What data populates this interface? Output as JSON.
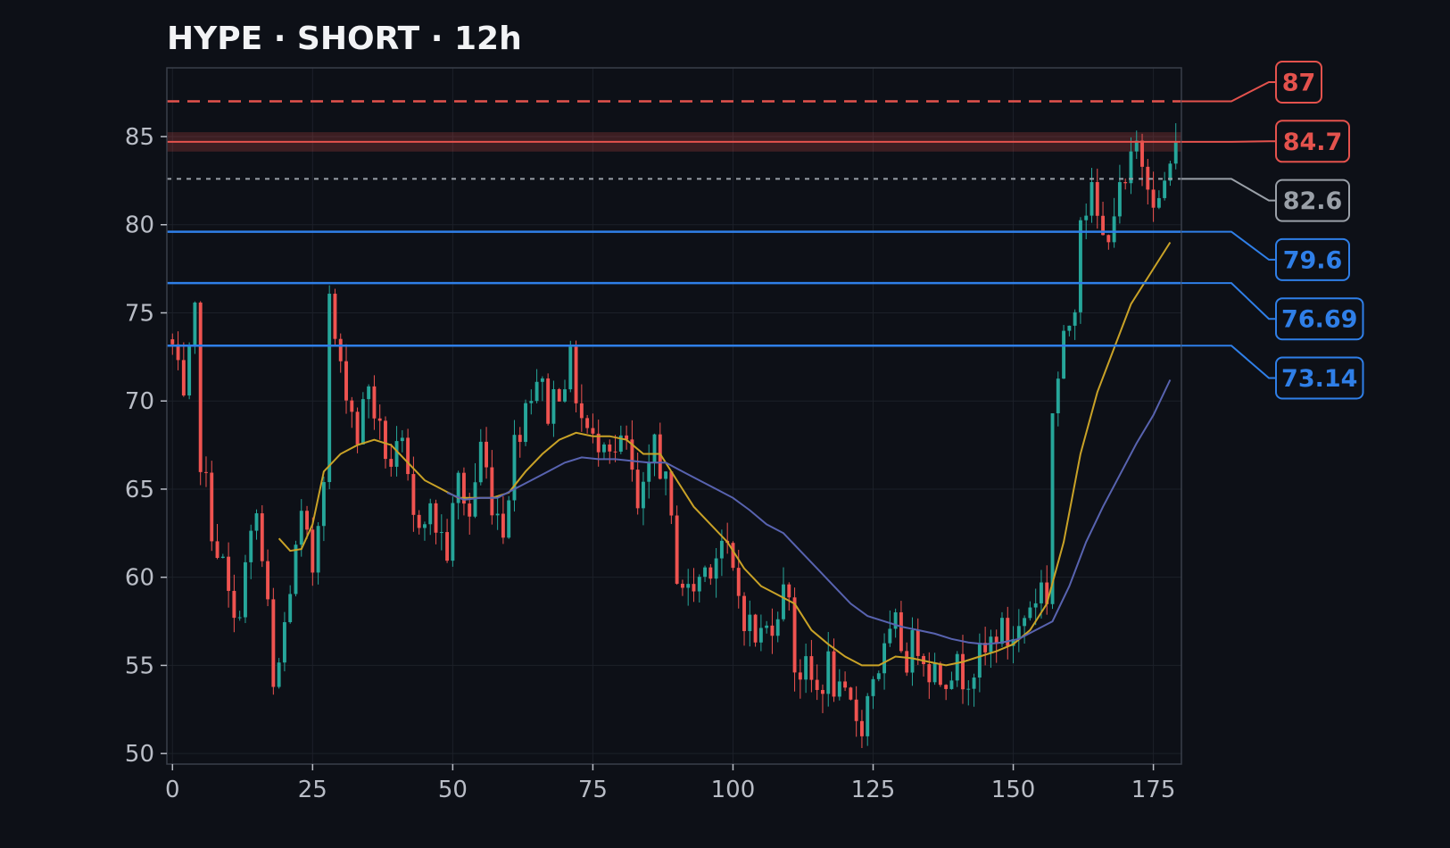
{
  "chart_data": {
    "type": "candlestick",
    "title": "HYPE · SHORT · 12h",
    "xlabel": "",
    "ylabel": "",
    "xlim": [
      -1,
      180
    ],
    "ylim": [
      49.4,
      88.9
    ],
    "x_ticks": [
      0,
      25,
      50,
      75,
      100,
      125,
      150,
      175
    ],
    "y_ticks": [
      50,
      55,
      60,
      65,
      70,
      75,
      80,
      85
    ],
    "grid": true,
    "close_path": [
      [
        0,
        73.0
      ],
      [
        2,
        69.5
      ],
      [
        4,
        74.5
      ],
      [
        5,
        67.0
      ],
      [
        7,
        63.0
      ],
      [
        9,
        60.5
      ],
      [
        11,
        57.0
      ],
      [
        13,
        60.5
      ],
      [
        15,
        63.5
      ],
      [
        17,
        58.0
      ],
      [
        18,
        53.3
      ],
      [
        19,
        55.0
      ],
      [
        21,
        59.5
      ],
      [
        23,
        63.0
      ],
      [
        25,
        60.5
      ],
      [
        27,
        66.5
      ],
      [
        28,
        75.5
      ],
      [
        30,
        71.5
      ],
      [
        31,
        71.0
      ],
      [
        33,
        68.0
      ],
      [
        35,
        71.0
      ],
      [
        37,
        68.0
      ],
      [
        39,
        66.5
      ],
      [
        41,
        67.0
      ],
      [
        43,
        63.0
      ],
      [
        45,
        64.0
      ],
      [
        47,
        63.0
      ],
      [
        49,
        61.5
      ],
      [
        51,
        65.5
      ],
      [
        53,
        63.5
      ],
      [
        55,
        67.5
      ],
      [
        57,
        64.5
      ],
      [
        59,
        63.0
      ],
      [
        61,
        67.5
      ],
      [
        63,
        70.0
      ],
      [
        65,
        71.5
      ],
      [
        67,
        69.5
      ],
      [
        69,
        71.0
      ],
      [
        71,
        72.0
      ],
      [
        73,
        69.0
      ],
      [
        75,
        67.5
      ],
      [
        77,
        68.5
      ],
      [
        79,
        67.0
      ],
      [
        81,
        67.5
      ],
      [
        83,
        63.5
      ],
      [
        85,
        65.5
      ],
      [
        86,
        68.0
      ],
      [
        88,
        65.0
      ],
      [
        90,
        60.5
      ],
      [
        92,
        59.0
      ],
      [
        94,
        60.0
      ],
      [
        96,
        61.0
      ],
      [
        98,
        62.0
      ],
      [
        100,
        60.0
      ],
      [
        102,
        58.0
      ],
      [
        104,
        56.5
      ],
      [
        106,
        57.0
      ],
      [
        108,
        58.5
      ],
      [
        110,
        59.5
      ],
      [
        111,
        55.0
      ],
      [
        113,
        54.5
      ],
      [
        115,
        53.5
      ],
      [
        117,
        55.0
      ],
      [
        119,
        53.0
      ],
      [
        121,
        52.5
      ],
      [
        123,
        51.8
      ],
      [
        125,
        54.5
      ],
      [
        127,
        55.5
      ],
      [
        129,
        57.0
      ],
      [
        131,
        55.5
      ],
      [
        133,
        56.5
      ],
      [
        135,
        55.0
      ],
      [
        137,
        54.5
      ],
      [
        139,
        55.0
      ],
      [
        141,
        54.5
      ],
      [
        143,
        55.0
      ],
      [
        145,
        55.5
      ],
      [
        147,
        57.0
      ],
      [
        149,
        56.5
      ],
      [
        151,
        57.0
      ],
      [
        153,
        58.5
      ],
      [
        155,
        59.5
      ],
      [
        156,
        59.0
      ],
      [
        157,
        69.5
      ],
      [
        159,
        73.0
      ],
      [
        161,
        76.0
      ],
      [
        162,
        81.0
      ],
      [
        164,
        81.5
      ],
      [
        166,
        79.0
      ],
      [
        168,
        81.0
      ],
      [
        170,
        82.0
      ],
      [
        172,
        84.5
      ],
      [
        174,
        83.0
      ],
      [
        176,
        81.0
      ],
      [
        178,
        83.5
      ],
      [
        179,
        84.0
      ]
    ],
    "ma_fast": [
      [
        19,
        62.2
      ],
      [
        21,
        61.5
      ],
      [
        23,
        61.6
      ],
      [
        25,
        63.0
      ],
      [
        27,
        66.0
      ],
      [
        30,
        67.0
      ],
      [
        33,
        67.5
      ],
      [
        36,
        67.8
      ],
      [
        39,
        67.5
      ],
      [
        42,
        66.5
      ],
      [
        45,
        65.5
      ],
      [
        48,
        65.0
      ],
      [
        51,
        64.5
      ],
      [
        54,
        64.5
      ],
      [
        57,
        64.5
      ],
      [
        60,
        64.8
      ],
      [
        63,
        66.0
      ],
      [
        66,
        67.0
      ],
      [
        69,
        67.8
      ],
      [
        72,
        68.2
      ],
      [
        75,
        68.0
      ],
      [
        78,
        68.0
      ],
      [
        81,
        67.8
      ],
      [
        84,
        67.0
      ],
      [
        87,
        67.0
      ],
      [
        90,
        65.5
      ],
      [
        93,
        64.0
      ],
      [
        96,
        63.0
      ],
      [
        99,
        62.0
      ],
      [
        102,
        60.5
      ],
      [
        105,
        59.5
      ],
      [
        108,
        59.0
      ],
      [
        111,
        58.5
      ],
      [
        114,
        57.0
      ],
      [
        117,
        56.2
      ],
      [
        120,
        55.5
      ],
      [
        123,
        55.0
      ],
      [
        126,
        55.0
      ],
      [
        129,
        55.5
      ],
      [
        132,
        55.4
      ],
      [
        135,
        55.2
      ],
      [
        138,
        55.0
      ],
      [
        141,
        55.2
      ],
      [
        144,
        55.5
      ],
      [
        147,
        55.8
      ],
      [
        150,
        56.2
      ],
      [
        153,
        57.0
      ],
      [
        156,
        58.5
      ],
      [
        159,
        62.0
      ],
      [
        162,
        67.0
      ],
      [
        165,
        70.5
      ],
      [
        168,
        73.0
      ],
      [
        171,
        75.5
      ],
      [
        174,
        77.0
      ],
      [
        178,
        79.0
      ]
    ],
    "ma_slow": [
      [
        49,
        64.8
      ],
      [
        52,
        64.4
      ],
      [
        55,
        64.5
      ],
      [
        58,
        64.5
      ],
      [
        61,
        65.0
      ],
      [
        64,
        65.5
      ],
      [
        67,
        66.0
      ],
      [
        70,
        66.5
      ],
      [
        73,
        66.8
      ],
      [
        76,
        66.7
      ],
      [
        79,
        66.7
      ],
      [
        82,
        66.6
      ],
      [
        85,
        66.5
      ],
      [
        88,
        66.5
      ],
      [
        91,
        66.0
      ],
      [
        94,
        65.5
      ],
      [
        97,
        65.0
      ],
      [
        100,
        64.5
      ],
      [
        103,
        63.8
      ],
      [
        106,
        63.0
      ],
      [
        109,
        62.5
      ],
      [
        112,
        61.5
      ],
      [
        115,
        60.5
      ],
      [
        118,
        59.5
      ],
      [
        121,
        58.5
      ],
      [
        124,
        57.8
      ],
      [
        127,
        57.5
      ],
      [
        130,
        57.2
      ],
      [
        133,
        57.0
      ],
      [
        136,
        56.8
      ],
      [
        139,
        56.5
      ],
      [
        142,
        56.3
      ],
      [
        145,
        56.2
      ],
      [
        148,
        56.3
      ],
      [
        151,
        56.5
      ],
      [
        154,
        57.0
      ],
      [
        157,
        57.5
      ],
      [
        160,
        59.5
      ],
      [
        163,
        62.0
      ],
      [
        166,
        64.0
      ],
      [
        169,
        65.8
      ],
      [
        172,
        67.6
      ],
      [
        175,
        69.2
      ],
      [
        178,
        71.2
      ]
    ],
    "levels": [
      {
        "value": 87,
        "label": "87",
        "color": "#e4524d",
        "style": "dashed"
      },
      {
        "value": 84.7,
        "label": "84.7",
        "color": "#e4524d",
        "style": "zone"
      },
      {
        "value": 82.6,
        "label": "82.6",
        "color": "#9aa0a8",
        "style": "dotted"
      },
      {
        "value": 79.6,
        "label": "79.6",
        "color": "#2f7fe8",
        "style": "solid"
      },
      {
        "value": 76.69,
        "label": "76.69",
        "color": "#2f7fe8",
        "style": "solid"
      },
      {
        "value": 73.14,
        "label": "73.14",
        "color": "#2f7fe8",
        "style": "solid"
      }
    ],
    "colors": {
      "background": "#0d1017",
      "up": "#26a69a",
      "down": "#ef5350",
      "ma_fast": "#c9a227",
      "ma_slow": "#5863b0",
      "grid": "#1c2029",
      "axis": "#3a3f4a"
    }
  }
}
